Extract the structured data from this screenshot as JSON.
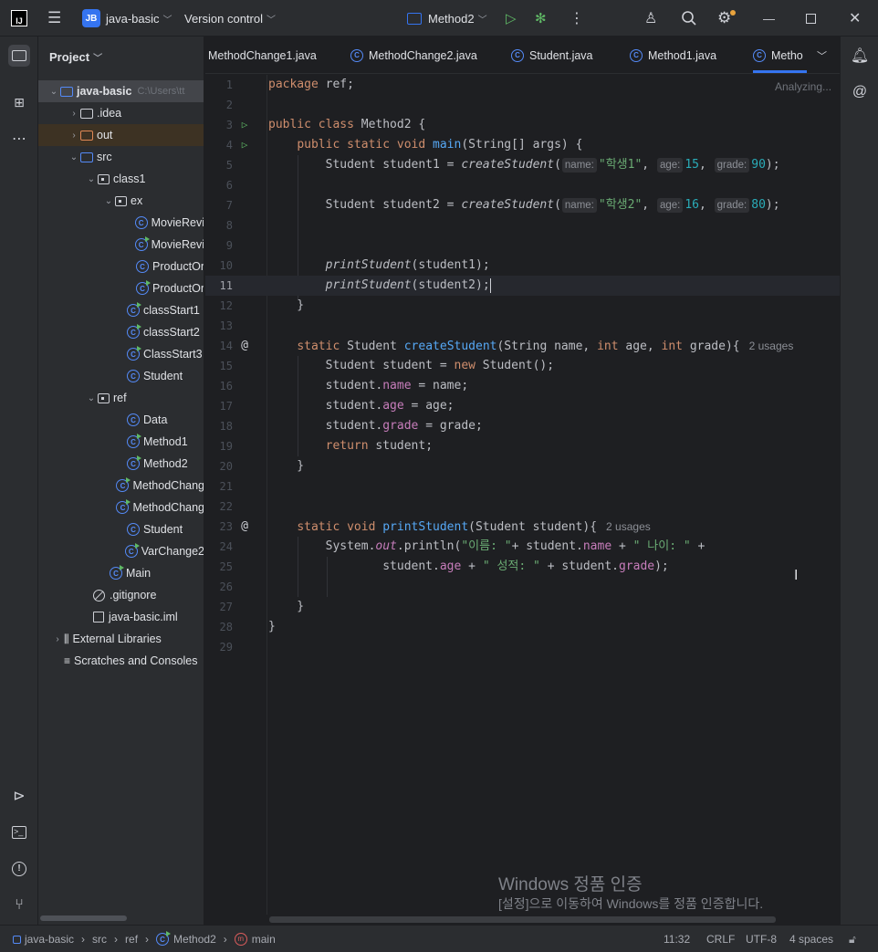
{
  "titlebar": {
    "project_badge": "JB",
    "project_name": "java-basic",
    "vcs": "Version control",
    "run_config": "Method2"
  },
  "project_panel": {
    "title": "Project",
    "root_name": "java-basic",
    "root_path": "C:\\Users\\tt",
    "items": [
      {
        "label": ".idea"
      },
      {
        "label": "out"
      },
      {
        "label": "src"
      },
      {
        "label": "class1"
      },
      {
        "label": "ex"
      },
      {
        "label": "MovieRevi"
      },
      {
        "label": "MovieRevi"
      },
      {
        "label": "ProductOr"
      },
      {
        "label": "ProductOr"
      },
      {
        "label": "classStart1"
      },
      {
        "label": "classStart2"
      },
      {
        "label": "ClassStart3"
      },
      {
        "label": "Student"
      },
      {
        "label": "ref"
      },
      {
        "label": "Data"
      },
      {
        "label": "Method1"
      },
      {
        "label": "Method2"
      },
      {
        "label": "MethodChang"
      },
      {
        "label": "MethodChang"
      },
      {
        "label": "Student"
      },
      {
        "label": "VarChange2"
      },
      {
        "label": "Main"
      },
      {
        "label": ".gitignore"
      },
      {
        "label": "java-basic.iml"
      },
      {
        "label": "External Libraries"
      },
      {
        "label": "Scratches and Consoles"
      }
    ]
  },
  "tabs": [
    {
      "label": "MethodChange1.java"
    },
    {
      "label": "MethodChange2.java"
    },
    {
      "label": "Student.java"
    },
    {
      "label": "Method1.java"
    },
    {
      "label": "Metho"
    }
  ],
  "editor": {
    "status": "Analyzing...",
    "line_numbers": [
      "1",
      "2",
      "3",
      "4",
      "5",
      "6",
      "7",
      "8",
      "9",
      "10",
      "11",
      "12",
      "13",
      "14",
      "15",
      "16",
      "17",
      "18",
      "19",
      "20",
      "21",
      "22",
      "23",
      "24",
      "25",
      "26",
      "27",
      "28",
      "29"
    ],
    "usages_create": "2 usages",
    "usages_print": "2 usages",
    "hint_name": "name:",
    "hint_age": "age:",
    "hint_grade": "grade:"
  },
  "watermark": {
    "line1": "Windows 정품 인증",
    "line2": "[설정]으로 이동하여 Windows를 정품 인증합니다."
  },
  "statusbar": {
    "crumbs": [
      "java-basic",
      "src",
      "ref",
      "Method2",
      "main"
    ],
    "position": "11:32",
    "line_sep": "CRLF",
    "encoding": "UTF-8",
    "indent": "4 spaces"
  },
  "colors": {
    "accent": "#3574f0",
    "run_green": "#5fb865",
    "keyword": "#cf8e6d",
    "function": "#56a8f5",
    "string": "#6aab73",
    "number": "#2aacb8",
    "field": "#c77dbb"
  }
}
